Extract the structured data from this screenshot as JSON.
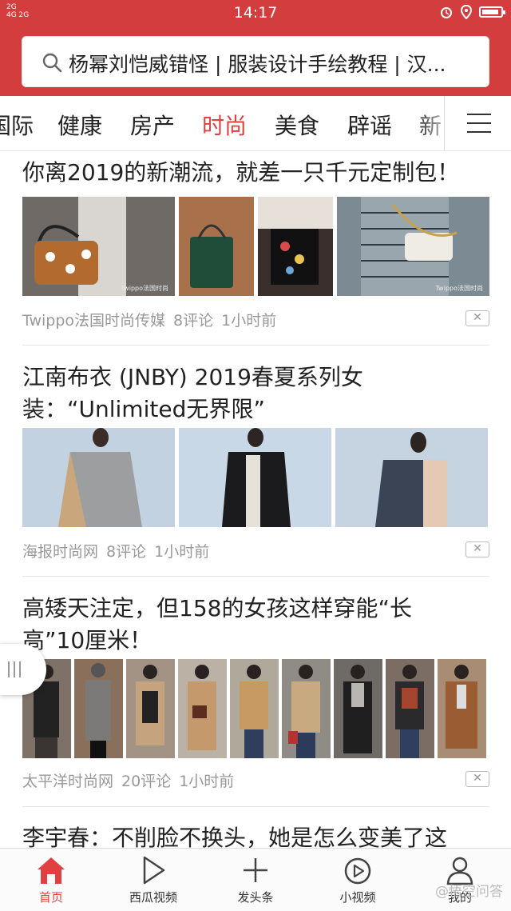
{
  "status_bar": {
    "signal_left": "2G",
    "signal_right": "4G 2G",
    "time": "14:17",
    "battery_level": 0.9
  },
  "search": {
    "query": "杨幂刘恺威错怪 | 服装设计手绘教程 | 汉..."
  },
  "tabs": [
    {
      "label": "国际"
    },
    {
      "label": "健康"
    },
    {
      "label": "房产"
    },
    {
      "label": "时尚",
      "active": true
    },
    {
      "label": "美食"
    },
    {
      "label": "辟谣"
    },
    {
      "label": "新"
    }
  ],
  "articles": [
    {
      "title": "你离2019的新潮流，就差一只千元定制包！",
      "source": "Twippo法国时尚传媒",
      "comments": "8评论",
      "time": "1小时前",
      "images": [
        {
          "caption": "Twippo法国时尚",
          "bg": "#6f6a66"
        },
        {
          "caption": "",
          "bg": "#a8714b"
        },
        {
          "caption": "",
          "bg": "#3b2f2b"
        },
        {
          "caption": "Twippo法国时尚",
          "bg": "#7c8a93"
        }
      ]
    },
    {
      "title": "江南布衣 (JNBY) 2019春夏系列女装：“Unlimited无界限”",
      "source": "海报时尚网",
      "comments": "8评论",
      "time": "1小时前",
      "images": [
        {
          "bg": "#c2d2e0"
        },
        {
          "bg": "#c8d8e6"
        },
        {
          "bg": "#c6d4e2"
        }
      ]
    },
    {
      "title": "高矮天注定，但158的女孩这样穿能“长高”10厘米！",
      "source": "太平洋时尚网",
      "comments": "20评论",
      "time": "1小时前",
      "images": [
        {
          "bg": "#7d7168"
        },
        {
          "bg": "#8a6f5a"
        },
        {
          "bg": "#a39384"
        },
        {
          "bg": "#bcb1a5"
        },
        {
          "bg": "#b1a89c"
        },
        {
          "bg": "#8f8b85"
        },
        {
          "bg": "#6e6a66"
        },
        {
          "bg": "#7b6d63"
        },
        {
          "bg": "#a88d74"
        }
      ]
    },
    {
      "title": "李宇春：不削脸不换头，她是怎么变美了这"
    }
  ],
  "bottom_nav": [
    {
      "label": "首页",
      "icon": "home-icon",
      "active": true
    },
    {
      "label": "西瓜视频",
      "icon": "play-icon"
    },
    {
      "label": "发头条",
      "icon": "plus-icon"
    },
    {
      "label": "小视频",
      "icon": "video-icon"
    },
    {
      "label": "我的",
      "icon": "user-icon"
    }
  ],
  "watermark": "@悟空问答",
  "colors": {
    "brand_red": "#d43d3d",
    "active_red": "#e0403f"
  }
}
